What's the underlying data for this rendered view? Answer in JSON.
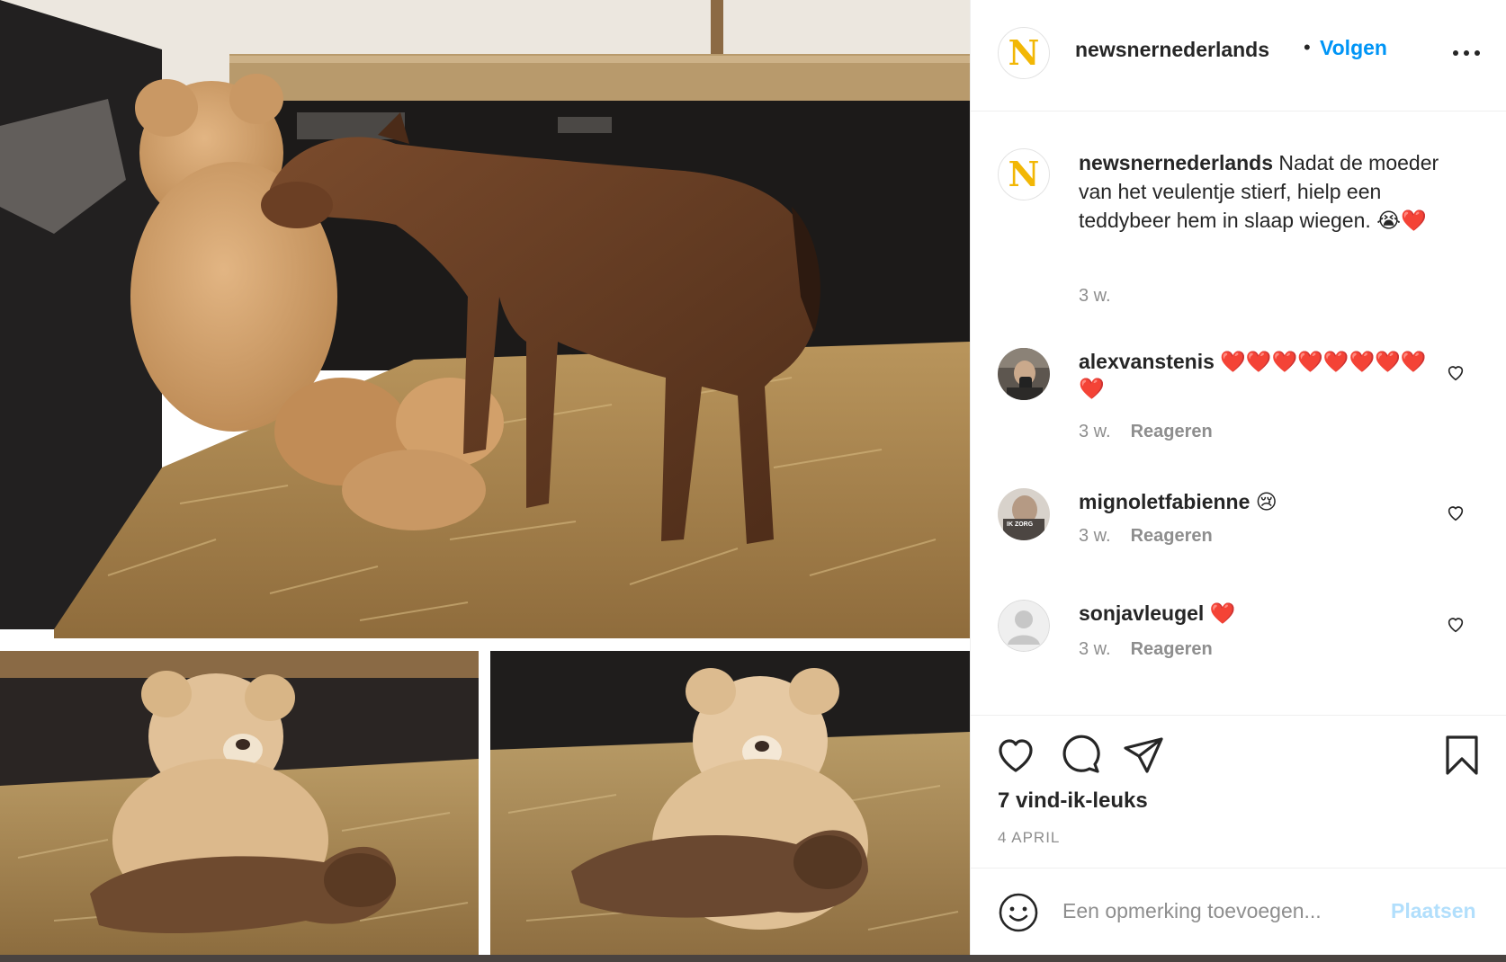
{
  "post": {
    "username": "newsnernederlands",
    "avatar_letter": "N",
    "separator": "•",
    "follow_label": "Volgen",
    "more_icon": "more-horizontal-icon"
  },
  "caption": {
    "username": "newsnernederlands",
    "text": "Nadat de moeder van het veulentje stierf, hielp een teddybeer hem in slaap wiegen. 😭❤️",
    "time": "3 w."
  },
  "comments": [
    {
      "username": "alexvanstenis",
      "text": "❤️❤️❤️❤️❤️❤️❤️❤️❤️",
      "time": "3 w.",
      "reply_label": "Reageren"
    },
    {
      "username": "mignoletfabienne",
      "text": "😢",
      "time": "3 w.",
      "reply_label": "Reageren",
      "avatar_caption": "IK ZORG"
    },
    {
      "username": "sonjavleugel",
      "text": "❤️",
      "time": "3 w.",
      "reply_label": "Reageren"
    }
  ],
  "actions": {
    "likes": "7 vind-ik-leuks",
    "date": "4 APRIL"
  },
  "add_comment": {
    "placeholder": "Een opmerking toevoegen...",
    "post_label": "Plaatsen"
  },
  "colors": {
    "link_blue": "#0095f6",
    "post_disabled": "#b2dffc",
    "brand_yellow": "#f2b705",
    "muted_text": "#8e8e8e"
  }
}
